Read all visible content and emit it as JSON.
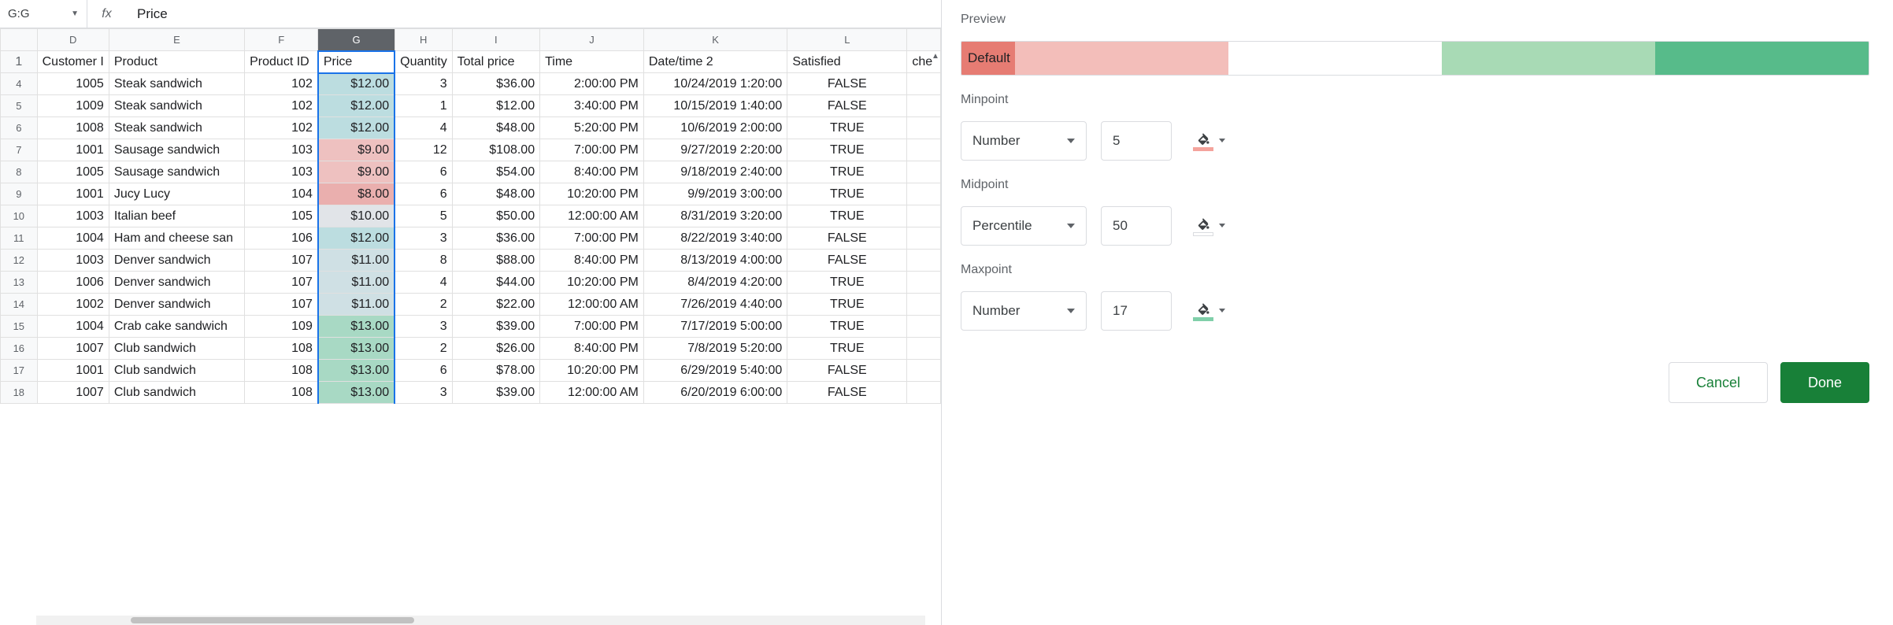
{
  "formula_bar": {
    "cell_ref": "G:G",
    "fx": "fx",
    "value": "Price"
  },
  "columns": [
    "D",
    "E",
    "F",
    "G",
    "H",
    "I",
    "J",
    "K",
    "L",
    ""
  ],
  "header_row": {
    "D": "Customer I",
    "E": "Product",
    "F": "Product ID",
    "G": "Price",
    "H": "Quantity",
    "I": "Total price",
    "J": "Time",
    "K": "Date/time 2",
    "L": "Satisfied",
    "M": "che"
  },
  "rows": [
    {
      "n": "4",
      "D": "1005",
      "E": "Steak sandwich",
      "F": "102",
      "G": "$12.00",
      "Gc": "#bcdde0",
      "H": "3",
      "I": "$36.00",
      "J": "2:00:00 PM",
      "K": "10/24/2019 1:20:00",
      "L": "FALSE"
    },
    {
      "n": "5",
      "D": "1009",
      "E": "Steak sandwich",
      "F": "102",
      "G": "$12.00",
      "Gc": "#bcdde0",
      "H": "1",
      "I": "$12.00",
      "J": "3:40:00 PM",
      "K": "10/15/2019 1:40:00",
      "L": "FALSE"
    },
    {
      "n": "6",
      "D": "1008",
      "E": "Steak sandwich",
      "F": "102",
      "G": "$12.00",
      "Gc": "#bcdde0",
      "H": "4",
      "I": "$48.00",
      "J": "5:20:00 PM",
      "K": "10/6/2019 2:00:00",
      "L": "TRUE"
    },
    {
      "n": "7",
      "D": "1001",
      "E": "Sausage sandwich",
      "F": "103",
      "G": "$9.00",
      "Gc": "#eec1c0",
      "H": "12",
      "I": "$108.00",
      "J": "7:00:00 PM",
      "K": "9/27/2019 2:20:00",
      "L": "TRUE"
    },
    {
      "n": "8",
      "D": "1005",
      "E": "Sausage sandwich",
      "F": "103",
      "G": "$9.00",
      "Gc": "#eec1c0",
      "H": "6",
      "I": "$54.00",
      "J": "8:40:00 PM",
      "K": "9/18/2019 2:40:00",
      "L": "TRUE"
    },
    {
      "n": "9",
      "D": "1001",
      "E": "Jucy Lucy",
      "F": "104",
      "G": "$8.00",
      "Gc": "#eaafae",
      "H": "6",
      "I": "$48.00",
      "J": "10:20:00 PM",
      "K": "9/9/2019 3:00:00",
      "L": "TRUE"
    },
    {
      "n": "10",
      "D": "1003",
      "E": "Italian beef",
      "F": "105",
      "G": "$10.00",
      "Gc": "#e1e4e8",
      "H": "5",
      "I": "$50.00",
      "J": "12:00:00 AM",
      "K": "8/31/2019 3:20:00",
      "L": "TRUE"
    },
    {
      "n": "11",
      "D": "1004",
      "E": "Ham and cheese san",
      "F": "106",
      "G": "$12.00",
      "Gc": "#bcdde0",
      "H": "3",
      "I": "$36.00",
      "J": "7:00:00 PM",
      "K": "8/22/2019 3:40:00",
      "L": "FALSE"
    },
    {
      "n": "12",
      "D": "1003",
      "E": "Denver sandwich",
      "F": "107",
      "G": "$11.00",
      "Gc": "#cfe0e4",
      "H": "8",
      "I": "$88.00",
      "J": "8:40:00 PM",
      "K": "8/13/2019 4:00:00",
      "L": "FALSE"
    },
    {
      "n": "13",
      "D": "1006",
      "E": "Denver sandwich",
      "F": "107",
      "G": "$11.00",
      "Gc": "#cfe0e4",
      "H": "4",
      "I": "$44.00",
      "J": "10:20:00 PM",
      "K": "8/4/2019 4:20:00",
      "L": "TRUE"
    },
    {
      "n": "14",
      "D": "1002",
      "E": "Denver sandwich",
      "F": "107",
      "G": "$11.00",
      "Gc": "#cfe0e4",
      "H": "2",
      "I": "$22.00",
      "J": "12:00:00 AM",
      "K": "7/26/2019 4:40:00",
      "L": "TRUE"
    },
    {
      "n": "15",
      "D": "1004",
      "E": "Crab cake sandwich",
      "F": "109",
      "G": "$13.00",
      "Gc": "#a8d9c4",
      "H": "3",
      "I": "$39.00",
      "J": "7:00:00 PM",
      "K": "7/17/2019 5:00:00",
      "L": "TRUE"
    },
    {
      "n": "16",
      "D": "1007",
      "E": "Club sandwich",
      "F": "108",
      "G": "$13.00",
      "Gc": "#a8d9c4",
      "H": "2",
      "I": "$26.00",
      "J": "8:40:00 PM",
      "K": "7/8/2019 5:20:00",
      "L": "TRUE"
    },
    {
      "n": "17",
      "D": "1001",
      "E": "Club sandwich",
      "F": "108",
      "G": "$13.00",
      "Gc": "#a8d9c4",
      "H": "6",
      "I": "$78.00",
      "J": "10:20:00 PM",
      "K": "6/29/2019 5:40:00",
      "L": "FALSE"
    },
    {
      "n": "18",
      "D": "1007",
      "E": "Club sandwich",
      "F": "108",
      "G": "$13.00",
      "Gc": "#a8d9c4",
      "H": "3",
      "I": "$39.00",
      "J": "12:00:00 AM",
      "K": "6/20/2019 6:00:00",
      "L": "FALSE"
    }
  ],
  "panel": {
    "preview_label": "Preview",
    "default_label": "Default",
    "preview_colors": [
      "#e67c73",
      "#f3beba",
      "#ffffff",
      "#a8dab5",
      "#57bb8a"
    ],
    "minpoint_label": "Minpoint",
    "min_type": "Number",
    "min_value": "5",
    "min_color": "#f4a39c",
    "midpoint_label": "Midpoint",
    "mid_type": "Percentile",
    "mid_value": "50",
    "mid_color": "#ffffff",
    "maxpoint_label": "Maxpoint",
    "max_type": "Number",
    "max_value": "17",
    "max_color": "#80cfa9",
    "cancel": "Cancel",
    "done": "Done"
  },
  "col_widths": {
    "D": 90,
    "E": 170,
    "F": 92,
    "G": 96,
    "H": 72,
    "I": 110,
    "J": 130,
    "K": 180,
    "L": 150,
    "M": 42
  }
}
